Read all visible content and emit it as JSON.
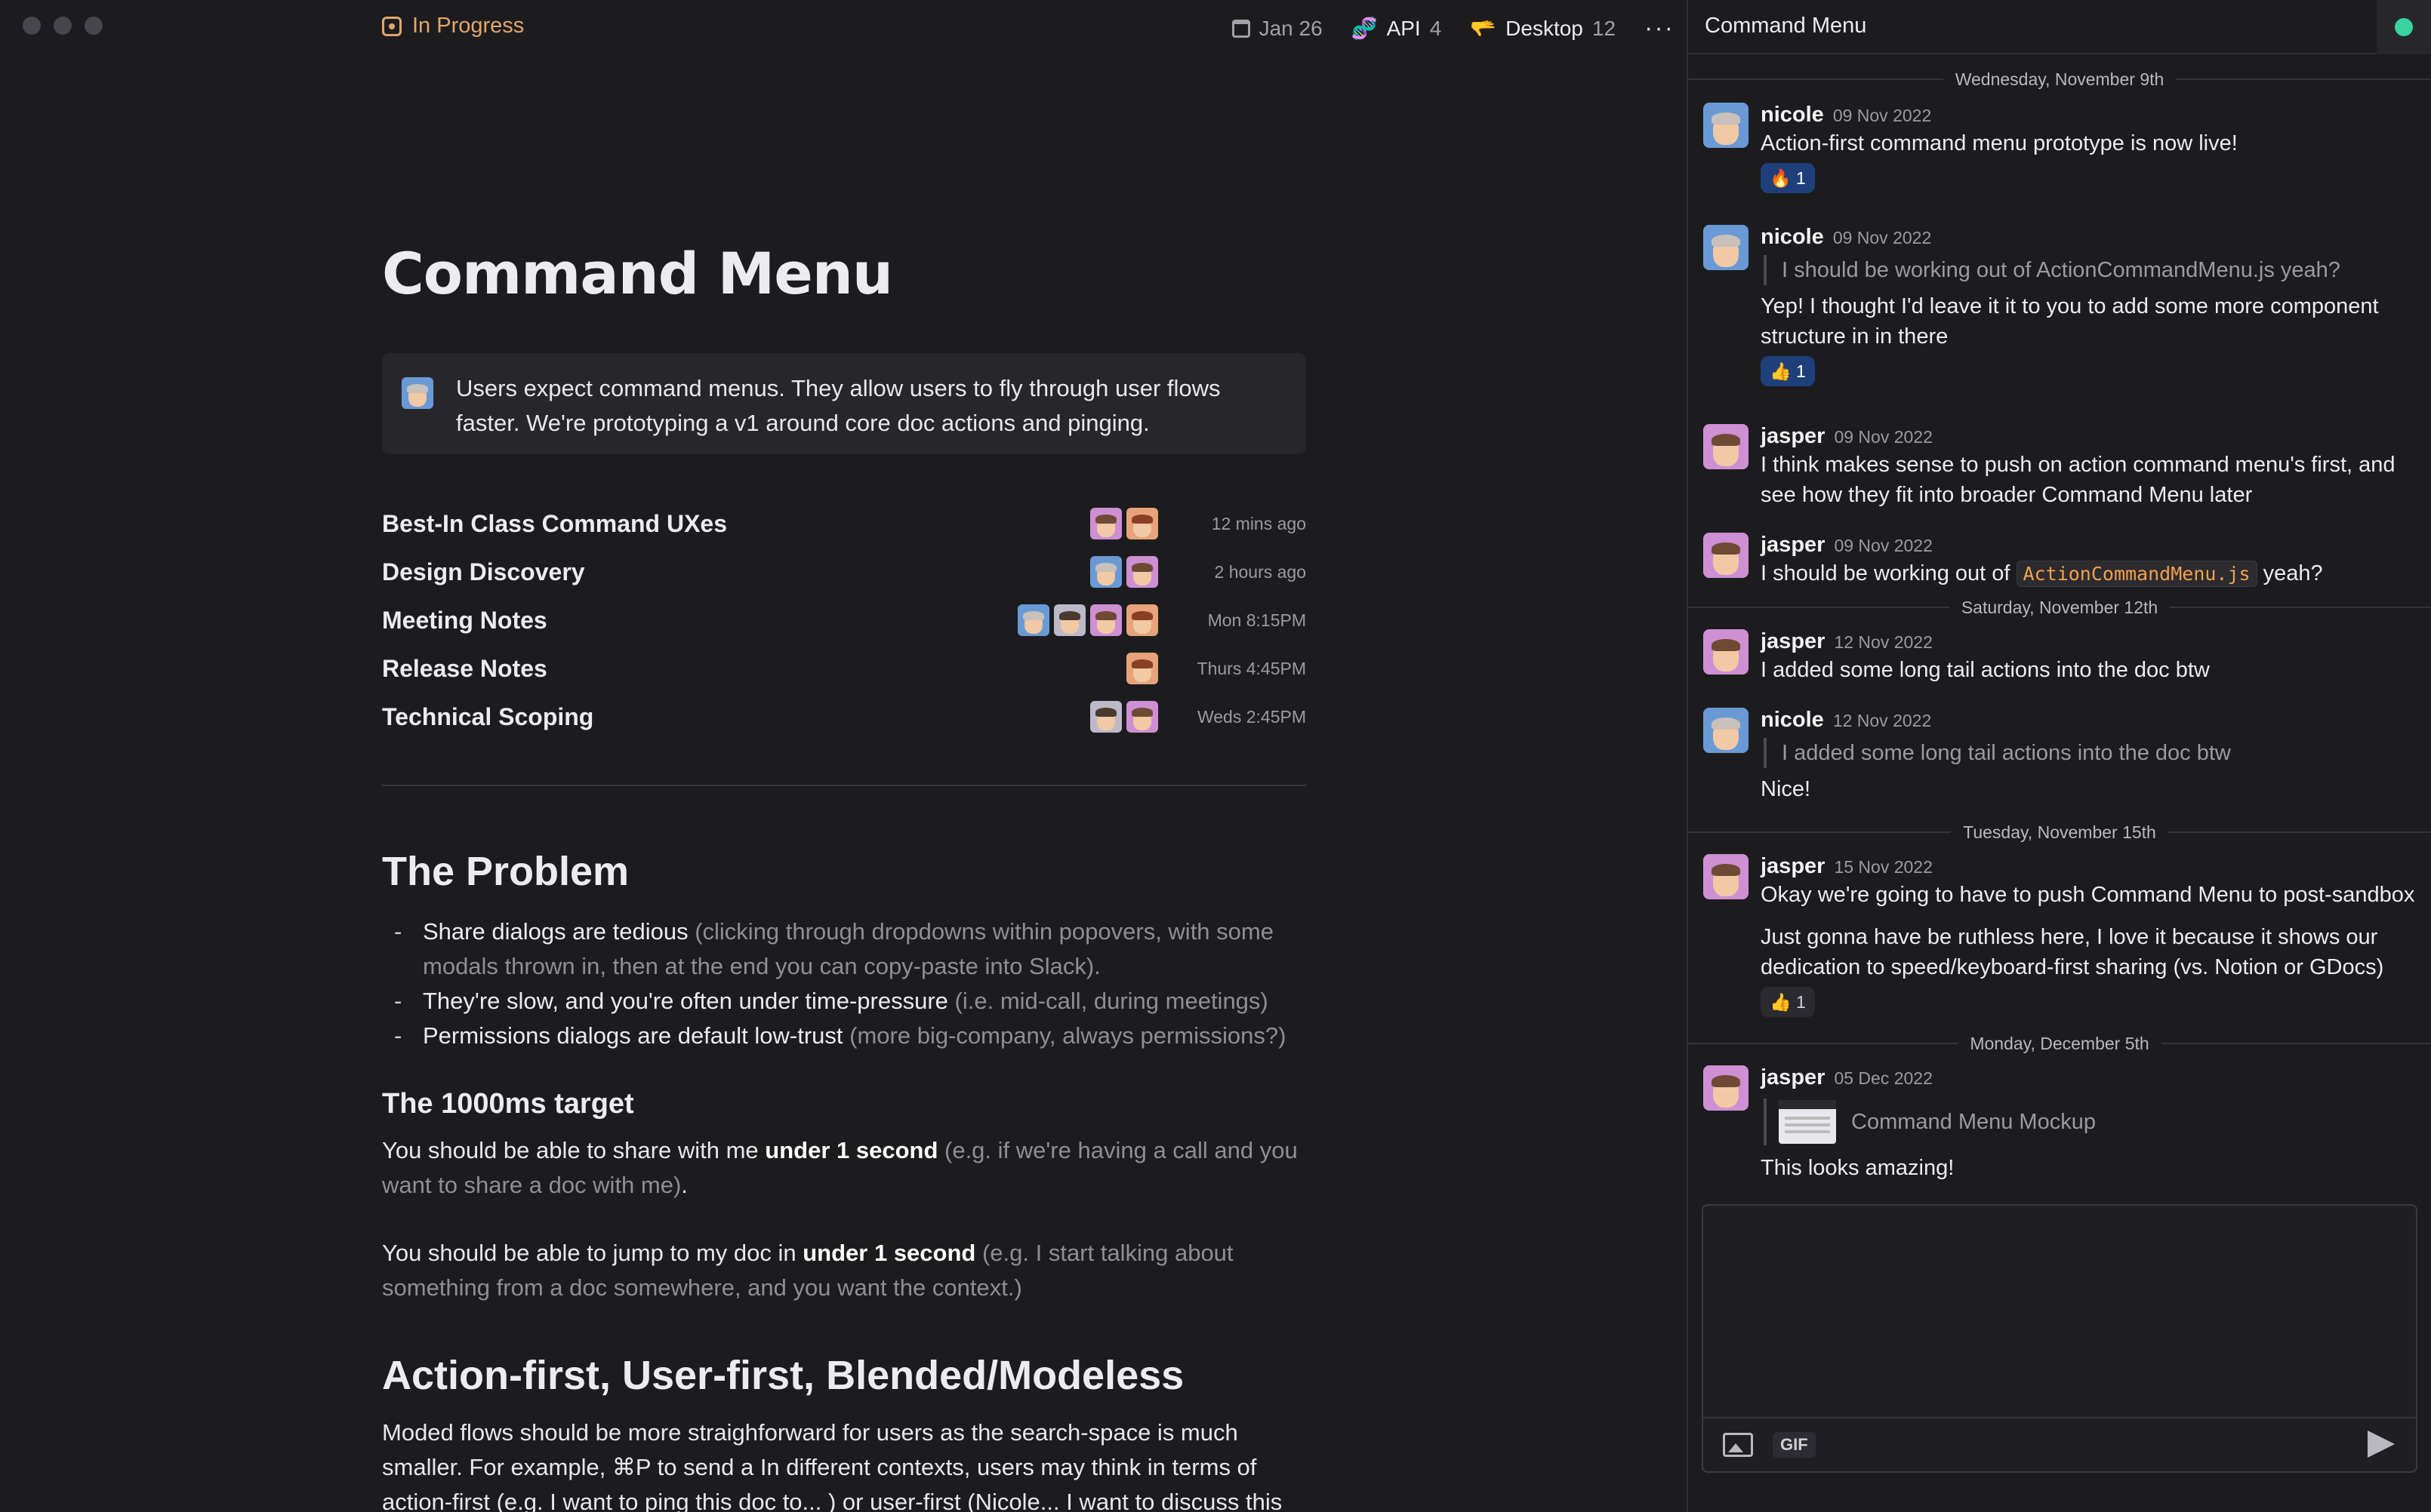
{
  "doc": {
    "status": "In Progress",
    "meta": {
      "date": "Jan 26",
      "api_label": "API",
      "api_count": "4",
      "desktop_label": "Desktop",
      "desktop_count": "12",
      "more": "···"
    },
    "title": "Command Menu",
    "callout": "Users expect command menus. They allow users to fly through user flows faster. We're prototyping a v1 around core doc actions and pinging.",
    "subdocs": [
      {
        "name": "Best-In Class Command UXes",
        "time": "12 mins ago"
      },
      {
        "name": "Design Discovery",
        "time": "2 hours ago"
      },
      {
        "name": "Meeting Notes",
        "time": "Mon 8:15PM"
      },
      {
        "name": "Release Notes",
        "time": "Thurs 4:45PM"
      },
      {
        "name": "Technical Scoping",
        "time": "Weds 2:45PM"
      }
    ],
    "problem": {
      "heading": "The Problem",
      "bullets": [
        {
          "main": "Share dialogs are tedious",
          "aside": "(clicking through dropdowns within popovers, with some modals thrown in, then at the end you can copy-paste into Slack)."
        },
        {
          "main": "They're slow, and you're often under time-pressure",
          "aside": "(i.e. mid-call, during meetings)"
        },
        {
          "main": "Permissions dialogs are default low-trust",
          "aside": "(more big-company, always permissions?)"
        }
      ]
    },
    "target": {
      "heading": "The 1000ms target",
      "p1_a": "You should be able to share with me",
      "p1_b": "under 1 second",
      "p1_c": "(e.g. if we're having a call and you want to share a doc with me)",
      "p1_d": ".",
      "p2_a": "You should be able to jump to my doc in",
      "p2_b": "under 1 second",
      "p2_c": "(e.g. I start talking about something from a doc somewhere, and you want the context.)"
    },
    "action": {
      "heading": "Action-first, User-first, Blended/Modeless",
      "text": "Moded flows should be more straighforward for users as the search-space is much smaller. For example, ⌘P to send a In different contexts, users may think in terms of action-first (e.g. I want to ping this doc to... ) or user-first (Nicole... I want to discuss this"
    }
  },
  "chat": {
    "title": "Command Menu",
    "date_separators": [
      "Wednesday, November 9th",
      "Saturday, November 12th",
      "Tuesday, November 15th",
      "Monday, December 5th"
    ],
    "messages": [
      {
        "user": "nicole",
        "date": "09 Nov 2022",
        "text": "Action-first command menu prototype is now live!",
        "reaction": "🔥 1"
      },
      {
        "user": "nicole",
        "date": "09 Nov 2022",
        "quote": "I should be working out of ActionCommandMenu.js yeah?",
        "text": "Yep! I thought I'd leave it it to you to add some more component structure in in there",
        "reaction": "👍 1"
      },
      {
        "user": "jasper",
        "date": "09 Nov 2022",
        "text": "I think makes sense to push on action command menu's first, and see how they fit into broader Command Menu later"
      },
      {
        "user": "jasper",
        "date": "09 Nov 2022",
        "text_a": "I should be working out of",
        "code": "ActionCommandMenu.js",
        "text_b": "yeah?"
      },
      {
        "user": "jasper",
        "date": "12 Nov 2022",
        "text": "I added some long tail actions into the doc btw"
      },
      {
        "user": "nicole",
        "date": "12 Nov 2022",
        "quote": "I added some long tail actions into the doc btw",
        "text": "Nice!"
      },
      {
        "user": "jasper",
        "date": "15 Nov 2022",
        "text": "Okay we're going to have to push Command Menu to post-sandbox",
        "text2": "Just gonna have be ruthless here, I love it because it shows our dedication to speed/keyboard-first sharing (vs. Notion or GDocs)",
        "reaction": "👍 1"
      },
      {
        "user": "jasper",
        "date": "05 Dec 2022",
        "attachment": "Command Menu Mockup",
        "text": "This looks amazing!"
      }
    ],
    "composer": {
      "placeholder": "",
      "gif_label": "GIF"
    }
  },
  "colors": {
    "background": "#1c1c1f",
    "status_accent": "#e3a66a",
    "reaction_bg": "#1e3f7a",
    "code_text": "#f5a04a",
    "presence": "#3ad29f"
  },
  "icons": [
    "status-icon",
    "calendar-icon",
    "api-icon",
    "desktop-icon",
    "more-icon",
    "image-icon",
    "send-icon",
    "presence-icon"
  ]
}
